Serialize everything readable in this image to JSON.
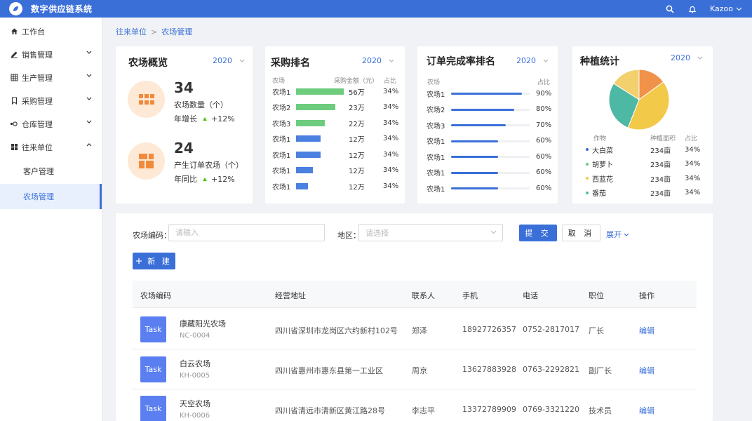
{
  "app": {
    "title": "数字供应链系统",
    "user": "Kazoo"
  },
  "sidebar": {
    "items": [
      {
        "label": "工作台"
      },
      {
        "label": "销售管理"
      },
      {
        "label": "生产管理"
      },
      {
        "label": "采购管理"
      },
      {
        "label": "仓库管理"
      },
      {
        "label": "往来单位"
      }
    ],
    "sub_items": [
      {
        "label": "客户管理"
      },
      {
        "label": "农场管理"
      }
    ]
  },
  "breadcrumb": {
    "parent": "往来单位",
    "sep": ">",
    "current": "农场管理"
  },
  "overview": {
    "title": "农场概览",
    "year": "2020",
    "stats": [
      {
        "number": "34",
        "label": "农场数量（个）",
        "growth_label": "年增长",
        "growth": "+12%"
      },
      {
        "number": "24",
        "label": "产生订单农场（个）",
        "growth_label": "年同比",
        "growth": "+12%"
      }
    ]
  },
  "purchase_rank": {
    "title": "采购排名",
    "year": "2020",
    "headers": {
      "farm": "农场",
      "amount": "采购金额（元）",
      "ratio": "占比"
    },
    "color": "#6dcc7e",
    "color_alt": "#4a80e0",
    "rows": [
      {
        "farm": "农场1",
        "amount": "56万",
        "ratio": "34%",
        "value": 56
      },
      {
        "farm": "农场2",
        "amount": "23万",
        "ratio": "34%",
        "value": 46
      },
      {
        "farm": "农场3",
        "amount": "22万",
        "ratio": "34%",
        "value": 34
      },
      {
        "farm": "农场1",
        "amount": "12万",
        "ratio": "34%",
        "value": 29
      },
      {
        "farm": "农场1",
        "amount": "12万",
        "ratio": "34%",
        "value": 29
      },
      {
        "farm": "农场1",
        "amount": "12万",
        "ratio": "34%",
        "value": 20
      },
      {
        "farm": "农场1",
        "amount": "12万",
        "ratio": "34%",
        "value": 14
      }
    ]
  },
  "order_rank": {
    "title": "订单完成率排名",
    "year": "2020",
    "headers": {
      "farm": "农场",
      "ratio": "占比"
    },
    "rows": [
      {
        "farm": "农场1",
        "ratio": "90%",
        "value": 0.9
      },
      {
        "farm": "农场2",
        "ratio": "80%",
        "value": 0.8
      },
      {
        "farm": "农场3",
        "ratio": "70%",
        "value": 0.7
      },
      {
        "farm": "农场1",
        "ratio": "60%",
        "value": 0.6
      },
      {
        "farm": "农场1",
        "ratio": "60%",
        "value": 0.6
      },
      {
        "farm": "农场1",
        "ratio": "60%",
        "value": 0.6
      },
      {
        "farm": "农场1",
        "ratio": "60%",
        "value": 0.6
      }
    ]
  },
  "planting": {
    "title": "种植统计",
    "year": "2020",
    "headers": {
      "crop": "作物",
      "area": "种植面积",
      "ratio": "占比"
    },
    "rows": [
      {
        "crop": "大白菜",
        "area": "234亩",
        "ratio": "34%",
        "color": "#3a6fd8"
      },
      {
        "crop": "胡萝卜",
        "area": "234亩",
        "ratio": "34%",
        "color": "#6dcc7e"
      },
      {
        "crop": "西蓝花",
        "area": "234亩",
        "ratio": "34%",
        "color": "#f3c94a"
      },
      {
        "crop": "番茄",
        "area": "234亩",
        "ratio": "34%",
        "color": "#4db8a4"
      }
    ],
    "pie": [
      {
        "value": 0.15,
        "color": "#f0924a"
      },
      {
        "value": 0.41,
        "color": "#f3c94a"
      },
      {
        "value": 0.28,
        "color": "#4db8a4"
      },
      {
        "value": 0.16,
        "color": "#f2d06e"
      }
    ]
  },
  "filter": {
    "code_label": "农场编码：",
    "code_placeholder": "请输入",
    "region_label": "地区：",
    "region_placeholder": "请选择",
    "submit": "提 交",
    "cancel": "取 消",
    "expand": "展开",
    "new_button": "新 建"
  },
  "table": {
    "headers": [
      "农场编码",
      "经营地址",
      "联系人",
      "手机",
      "电话",
      "职位",
      "操作"
    ],
    "rows": [
      {
        "badge": "Task",
        "name": "康藏阳光农场",
        "code": "NC-0004",
        "address": "四川省深圳市龙岗区六约新村102号",
        "contact": "郑泽",
        "mobile": "18927726357",
        "phone": "0752-2817017",
        "position": "厂长",
        "action": "编辑"
      },
      {
        "badge": "Task",
        "name": "白云农场",
        "code": "KH-0005",
        "address": "四川省惠州市惠东县第一工业区",
        "contact": "周京",
        "mobile": "13627883928",
        "phone": "0763-2292821",
        "position": "副厂长",
        "action": "编辑"
      },
      {
        "badge": "Task",
        "name": "天空农场",
        "code": "KH-0006",
        "address": "四川省清远市清新区黄江路28号",
        "contact": "李志平",
        "mobile": "13372789909",
        "phone": "0769-3321220",
        "position": "技术员",
        "action": "编辑"
      }
    ]
  }
}
